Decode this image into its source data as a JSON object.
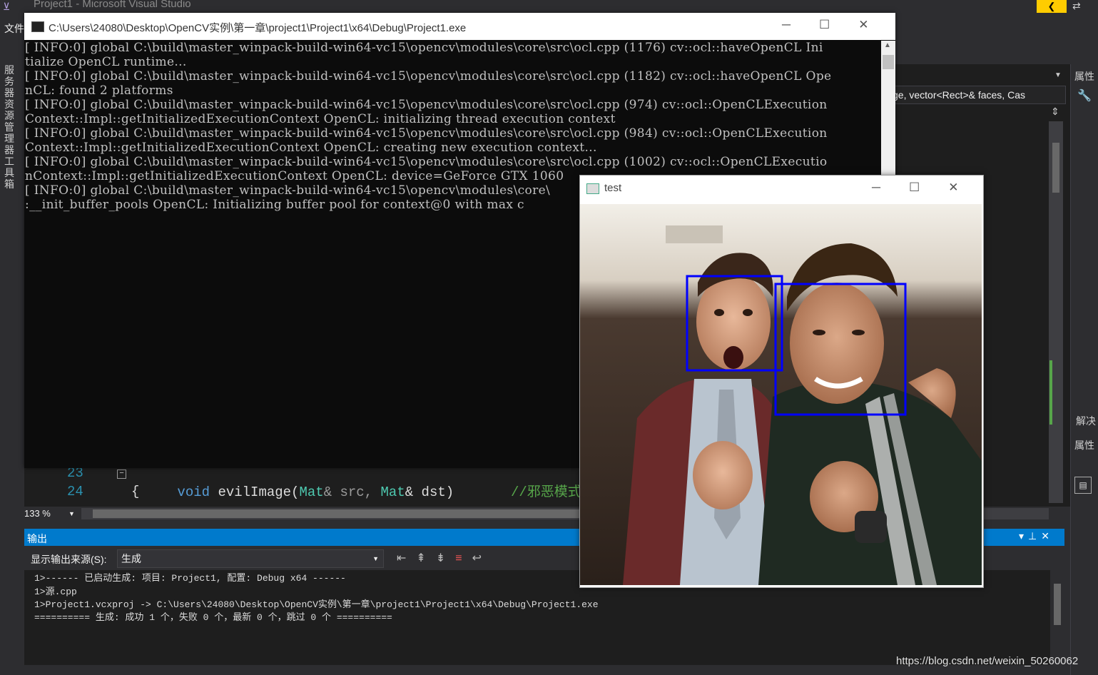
{
  "vs": {
    "title": "Project1 - Microsoft Visual Studio",
    "menu_file": "文件",
    "left_tabs": "服务器资源管理器 工具箱",
    "notification": "❮",
    "right_panel": {
      "props_top": "属性",
      "solution": "解决",
      "props_bottom": "属性"
    },
    "nav_dropdown": "ge, vector<Rect>& faces, Cas"
  },
  "editor": {
    "lines": [
      {
        "number": "23",
        "keyword": "void",
        "text": "evilImage(",
        "type1": "Mat",
        "p1": "& src, ",
        "type2": "Mat",
        "p2": "& dst)",
        "comment": "//邪恶模式"
      },
      {
        "number": "24",
        "text": "{"
      }
    ],
    "zoom": "133 %"
  },
  "output": {
    "title": "输出",
    "source_label": "显示输出来源(S):",
    "source_value": "生成",
    "lines": [
      "1>------ 已启动生成: 项目: Project1, 配置: Debug x64 ------",
      "1>源.cpp",
      "1>Project1.vcxproj -> C:\\Users\\24080\\Desktop\\OpenCV实例\\第一章\\project1\\Project1\\x64\\Debug\\Project1.exe",
      "========== 生成: 成功 1 个，失败 0 个，最新 0 个，跳过 0 个 =========="
    ]
  },
  "console": {
    "title": "C:\\Users\\24080\\Desktop\\OpenCV实例\\第一章\\project1\\Project1\\x64\\Debug\\Project1.exe",
    "lines": [
      "[ INFO:0] global C:\\build\\master_winpack-build-win64-vc15\\opencv\\modules\\core\\src\\ocl.cpp (1176) cv::ocl::haveOpenCL Ini",
      "tialize OpenCL runtime...",
      "[ INFO:0] global C:\\build\\master_winpack-build-win64-vc15\\opencv\\modules\\core\\src\\ocl.cpp (1182) cv::ocl::haveOpenCL Ope",
      "nCL: found 2 platforms",
      "[ INFO:0] global C:\\build\\master_winpack-build-win64-vc15\\opencv\\modules\\core\\src\\ocl.cpp (974) cv::ocl::OpenCLExecution",
      "Context::Impl::getInitializedExecutionContext OpenCL: initializing thread execution context",
      "[ INFO:0] global C:\\build\\master_winpack-build-win64-vc15\\opencv\\modules\\core\\src\\ocl.cpp (984) cv::ocl::OpenCLExecution",
      "Context::Impl::getInitializedExecutionContext OpenCL: creating new execution context...",
      "[ INFO:0] global C:\\build\\master_winpack-build-win64-vc15\\opencv\\modules\\core\\src\\ocl.cpp (1002) cv::ocl::OpenCLExecutio",
      "nContext::Impl::getInitializedExecutionContext OpenCL: device=GeForce GTX 1060",
      "[ INFO:0] global C:\\build\\master_winpack-build-win64-vc15\\opencv\\modules\\core\\",
      ":__init_buffer_pools OpenCL: Initializing buffer pool for context@0 with max c"
    ]
  },
  "image_window": {
    "title": "test",
    "box_color": "#0000ff"
  },
  "watermark": "https://blog.csdn.net/weixin_50260062"
}
